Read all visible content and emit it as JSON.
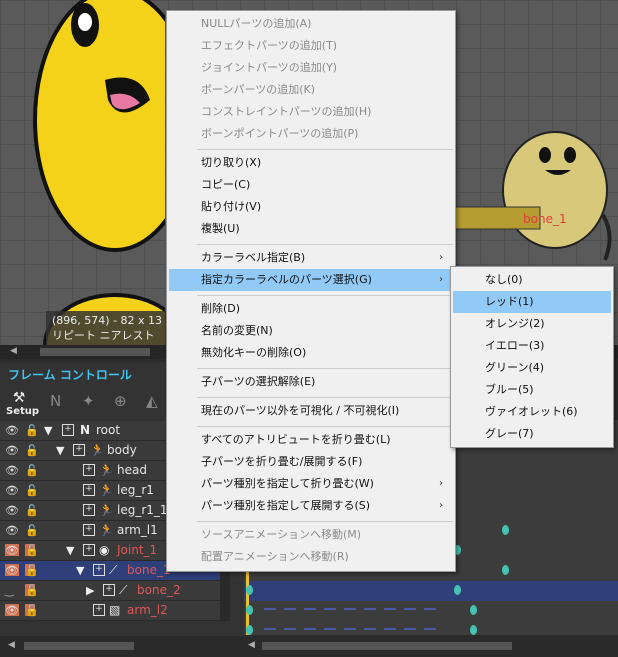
{
  "viewport": {
    "info_line1": "(896, 574) - 82 x 13",
    "info_line2": "リピート  ニアレスト",
    "bone_label": "bone_1"
  },
  "panel": {
    "title": "フレーム コントロール",
    "setup_label": "Setup",
    "rows": [
      {
        "label": "root"
      },
      {
        "label": "body"
      },
      {
        "label": "head"
      },
      {
        "label": "leg_r1"
      },
      {
        "label": "leg_r1_1"
      },
      {
        "label": "arm_l1"
      },
      {
        "label": "Joint_1"
      },
      {
        "label": "bone_1"
      },
      {
        "label": "bone_2"
      },
      {
        "label": "arm_l2"
      }
    ]
  },
  "context_menu": {
    "items": [
      {
        "label": "NULLパーツの追加(A)"
      },
      {
        "label": "エフェクトパーツの追加(T)"
      },
      {
        "label": "ジョイントパーツの追加(Y)"
      },
      {
        "label": "ボーンパーツの追加(K)"
      },
      {
        "label": "コンストレイントパーツの追加(H)"
      },
      {
        "label": "ボーンポイントパーツの追加(P)"
      },
      {
        "label": "切り取り(X)"
      },
      {
        "label": "コピー(C)"
      },
      {
        "label": "貼り付け(V)"
      },
      {
        "label": "複製(U)"
      },
      {
        "label": "カラーラベル指定(B)"
      },
      {
        "label": "指定カラーラベルのパーツ選択(G)"
      },
      {
        "label": "削除(D)"
      },
      {
        "label": "名前の変更(N)"
      },
      {
        "label": "無効化キーの削除(O)"
      },
      {
        "label": "子パーツの選択解除(E)"
      },
      {
        "label": "現在のパーツ以外を可視化 / 不可視化(I)"
      },
      {
        "label": "すべてのアトリビュートを折り畳む(L)"
      },
      {
        "label": "子パーツを折り畳む/展開する(F)"
      },
      {
        "label": "パーツ種別を指定して折り畳む(W)"
      },
      {
        "label": "パーツ種別を指定して展開する(S)"
      },
      {
        "label": "ソースアニメーションへ移動(M)"
      },
      {
        "label": "配置アニメーションへ移動(R)"
      }
    ]
  },
  "submenu": {
    "items": [
      {
        "label": "なし(0)"
      },
      {
        "label": "レッド(1)"
      },
      {
        "label": "オレンジ(2)"
      },
      {
        "label": "イエロー(3)"
      },
      {
        "label": "グリーン(4)"
      },
      {
        "label": "ブルー(5)"
      },
      {
        "label": "ヴァイオレット(6)"
      },
      {
        "label": "グレー(7)"
      }
    ]
  },
  "colors": {
    "highlight": "#91c9f7",
    "keyframe": "#45c4b4",
    "selected_row": "#2f3f7a",
    "red_label": "#e05858"
  }
}
